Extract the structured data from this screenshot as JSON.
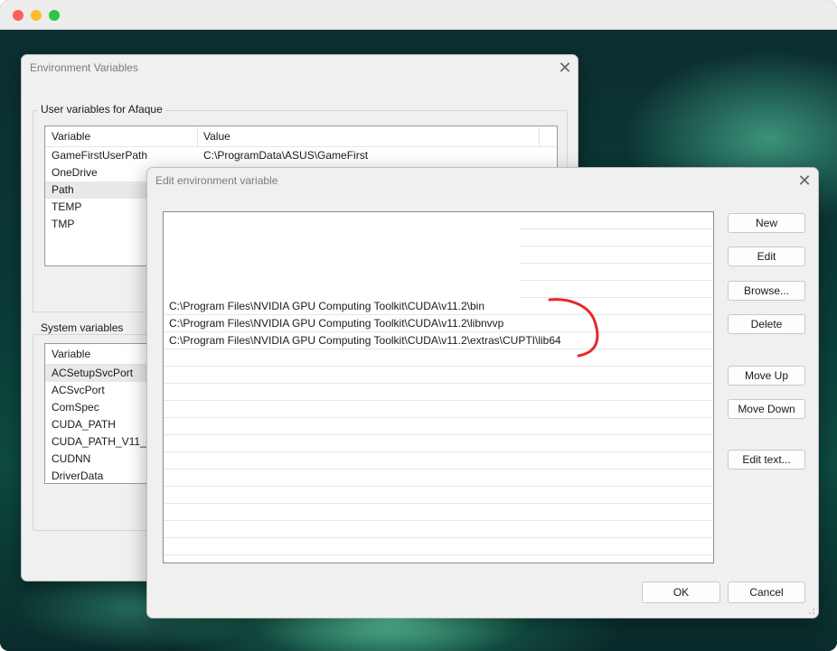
{
  "colors": {
    "accent": "#e8292b",
    "dialog_bg": "#f0f0f0"
  },
  "env_dialog": {
    "title": "Environment Variables",
    "user_group_label": "User variables for Afaque",
    "columns": [
      "Variable",
      "Value"
    ],
    "user_rows": [
      {
        "variable": "GameFirstUserPath",
        "value": "C:\\ProgramData\\ASUS\\GameFirst"
      },
      {
        "variable": "OneDrive",
        "value": ""
      },
      {
        "variable": "Path",
        "value": ""
      },
      {
        "variable": "TEMP",
        "value": ""
      },
      {
        "variable": "TMP",
        "value": ""
      }
    ],
    "system_group_label": "System variables",
    "system_column": "Variable",
    "system_rows": [
      "ACSetupSvcPort",
      "ACSvcPort",
      "ComSpec",
      "CUDA_PATH",
      "CUDA_PATH_V11_2",
      "CUDNN",
      "DriverData"
    ]
  },
  "edit_dialog": {
    "title": "Edit environment variable",
    "paths": [
      "",
      "",
      "",
      "",
      "",
      "C:\\Program Files\\NVIDIA GPU Computing Toolkit\\CUDA\\v11.2\\bin",
      "C:\\Program Files\\NVIDIA GPU Computing Toolkit\\CUDA\\v11.2\\libnvvp",
      "C:\\Program Files\\NVIDIA GPU Computing Toolkit\\CUDA\\v11.2\\extras\\CUPTI\\lib64"
    ],
    "buttons": {
      "new": "New",
      "edit": "Edit",
      "browse": "Browse...",
      "delete": "Delete",
      "move_up": "Move Up",
      "move_down": "Move Down",
      "edit_text": "Edit text...",
      "ok": "OK",
      "cancel": "Cancel"
    }
  },
  "icons": {
    "close": "close-icon",
    "annotation": "red-brace-annotation"
  }
}
